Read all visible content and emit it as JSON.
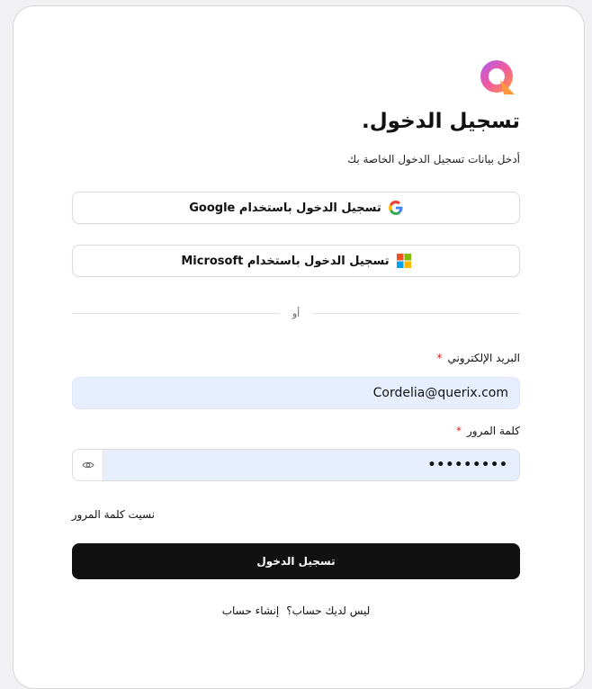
{
  "login": {
    "title": "تسجيل الدخول.",
    "subtitle": "أدخل بيانات تسجيل الدخول الخاصة بك",
    "google_button": "تسجيل الدخول باستخدام Google",
    "microsoft_button": "تسجيل الدخول باستخدام Microsoft",
    "divider_text": "أو",
    "email_label": "البريد الإلكتروني",
    "email_value": "Cordelia@querix.com",
    "password_label": "كلمة المرور",
    "password_value": "•••••••••",
    "required_marker": "*",
    "forgot_password": "نسيت كلمة المرور",
    "submit_button": "تسجيل الدخول",
    "no_account_text": "ليس لديك حساب؟",
    "create_account_link": "إنشاء حساب"
  },
  "icons": {
    "logo": "querix-logo-icon",
    "google": "google-icon",
    "microsoft": "microsoft-icon",
    "eye": "eye-icon"
  },
  "colors": {
    "accent": "#111111",
    "required": "#e02424",
    "input_fill": "#e7efff"
  }
}
